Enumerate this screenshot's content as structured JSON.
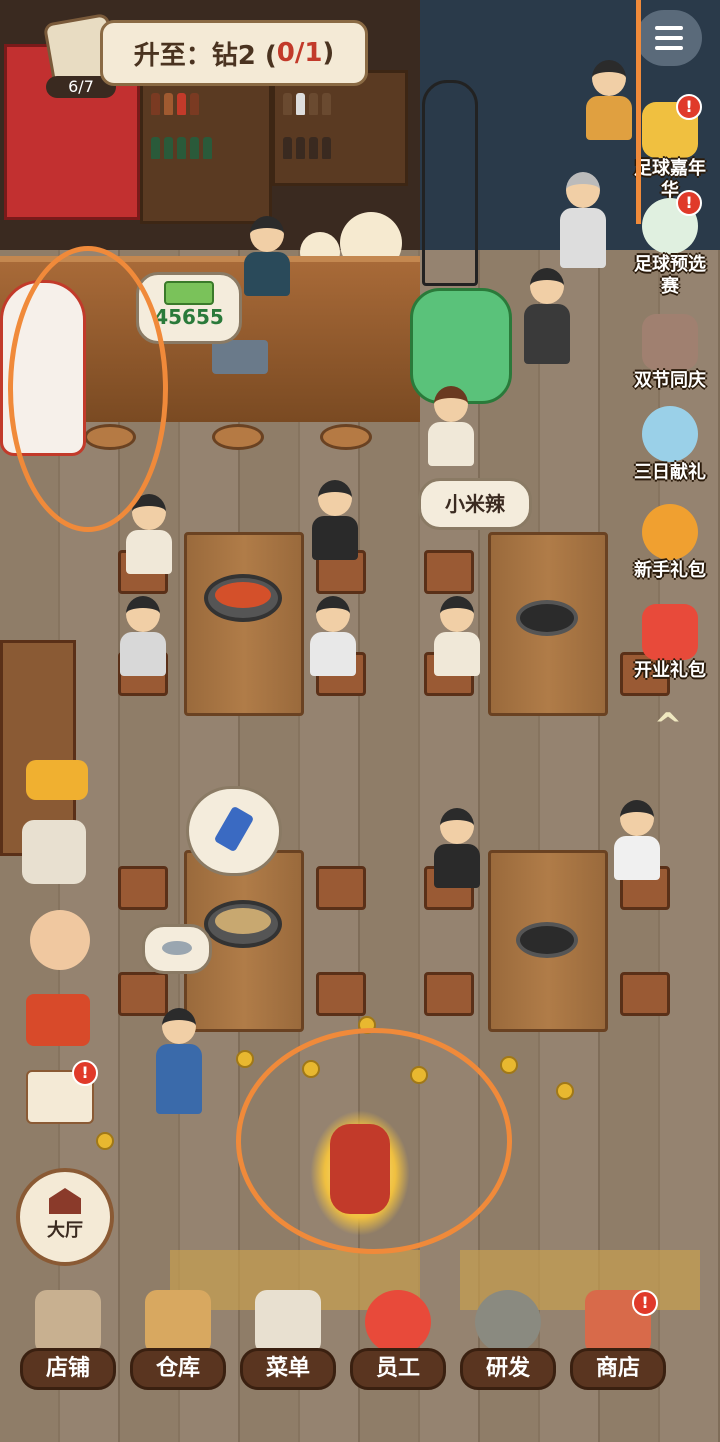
{
  "top": {
    "goal_prefix": "升至：",
    "goal_rank": "钻2 (",
    "goal_progress": "0/1",
    "goal_suffix": ")",
    "task_count": "6/7"
  },
  "money_bubble": "45655",
  "order_bubble": "小米辣",
  "side_events": [
    {
      "label": "足球嘉年华",
      "badge": "!"
    },
    {
      "label": "足球预选赛",
      "badge": "!"
    },
    {
      "label": "双节同庆",
      "badge": ""
    },
    {
      "label": "三日献礼",
      "badge": ""
    },
    {
      "label": "新手礼包",
      "badge": ""
    },
    {
      "label": "开业礼包",
      "badge": ""
    }
  ],
  "collapse_arrow": "^",
  "hall_button": "大厅",
  "bottom_nav": [
    {
      "label": "店铺",
      "badge": ""
    },
    {
      "label": "仓库",
      "badge": ""
    },
    {
      "label": "菜单",
      "badge": ""
    },
    {
      "label": "员工",
      "badge": ""
    },
    {
      "label": "研发",
      "badge": ""
    },
    {
      "label": "商店",
      "badge": "!"
    }
  ],
  "left_badge": "!",
  "colors": {
    "accent": "#f08a3a",
    "badge": "#e03a2a",
    "nav_bg": "#5a3520"
  }
}
